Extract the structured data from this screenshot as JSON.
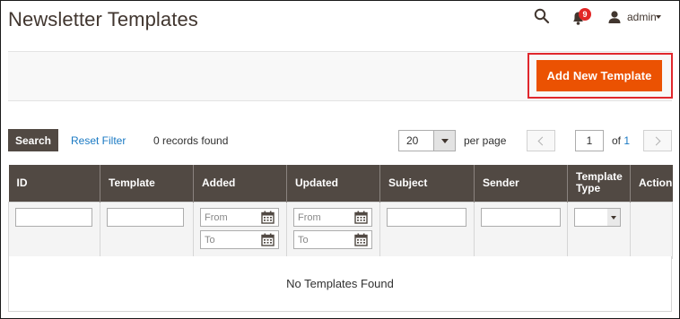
{
  "header": {
    "title": "Newsletter Templates",
    "notifications_count": "9",
    "user_name": "admin"
  },
  "actions": {
    "add_new_label": "Add New Template"
  },
  "grid_toolbar": {
    "search_label": "Search",
    "reset_filter_label": "Reset Filter",
    "records_found": "0 records found",
    "per_page_value": "20",
    "per_page_label": "per page",
    "current_page": "1",
    "of_label": "of ",
    "total_pages": "1"
  },
  "table": {
    "columns": [
      "ID",
      "Template",
      "Added",
      "Updated",
      "Subject",
      "Sender",
      "Template Type",
      "Action"
    ],
    "date_from_placeholder": "From",
    "date_to_placeholder": "To",
    "empty_message": "No Templates Found"
  },
  "colors": {
    "accent": "#eb5202",
    "header_bg": "#514943",
    "link": "#1979c3",
    "highlight": "#e0272d",
    "badge": "#e22626"
  }
}
